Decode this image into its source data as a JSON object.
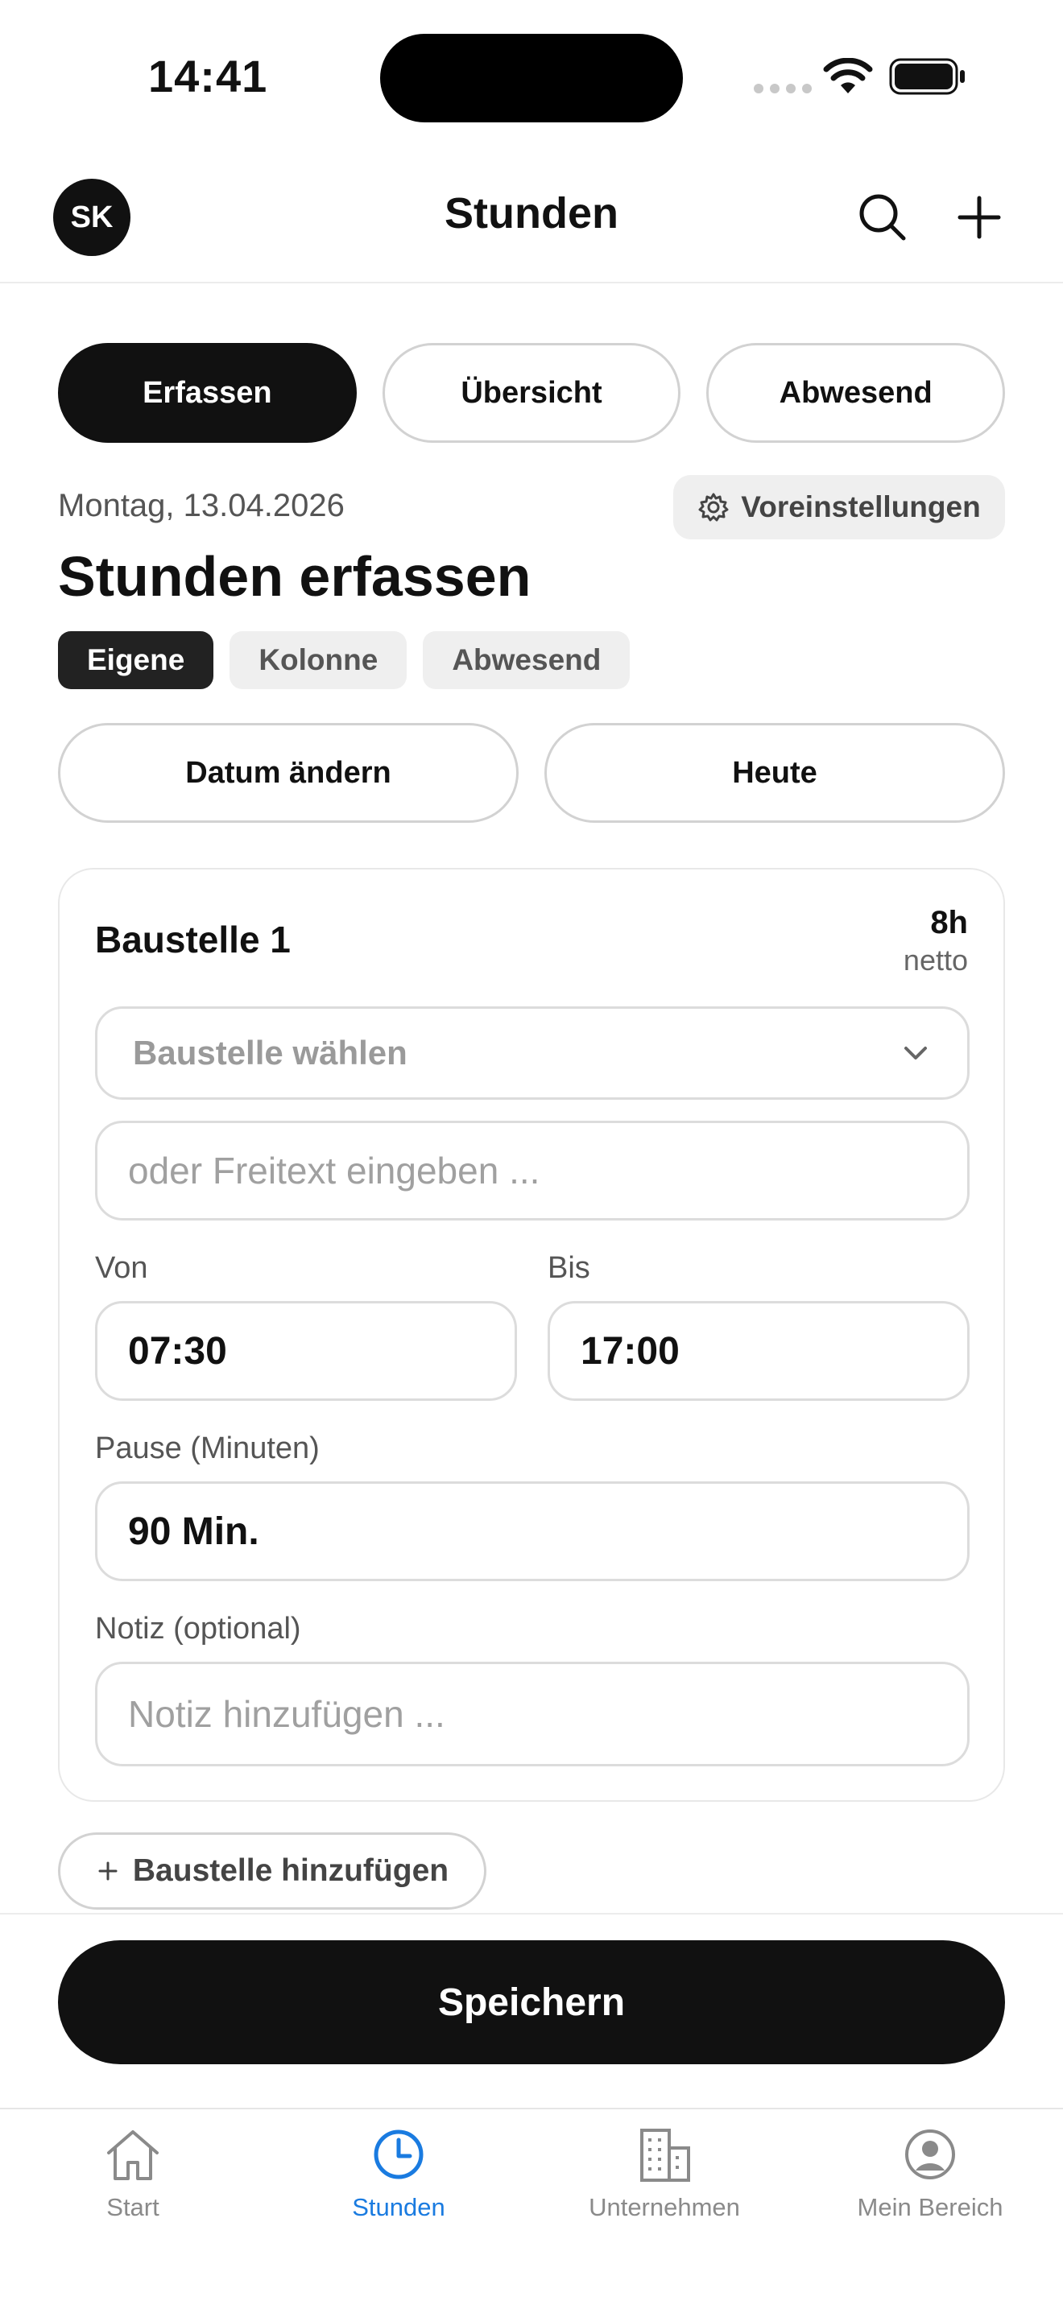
{
  "status_bar": {
    "time": "14:41"
  },
  "header": {
    "avatar_initials": "SK",
    "title": "Stunden"
  },
  "main_tabs": [
    {
      "label": "Erfassen",
      "active": true
    },
    {
      "label": "Übersicht",
      "active": false
    },
    {
      "label": "Abwesend",
      "active": false
    }
  ],
  "date_label": "Montag, 13.04.2026",
  "preset_button_label": "Voreinstellungen",
  "page_heading": "Stunden erfassen",
  "type_chips": [
    {
      "label": "Eigene",
      "active": true
    },
    {
      "label": "Kolonne",
      "active": false
    },
    {
      "label": "Abwesend",
      "active": false
    }
  ],
  "date_actions": {
    "change_label": "Datum ändern",
    "today_label": "Heute"
  },
  "entry_card": {
    "title": "Baustelle 1",
    "net_hours": "8h",
    "net_label": "netto",
    "site_select_placeholder": "Baustelle wählen",
    "freetext_placeholder": "oder Freitext eingeben ...",
    "from_label": "Von",
    "from_value": "07:30",
    "to_label": "Bis",
    "to_value": "17:00",
    "break_label": "Pause (Minuten)",
    "break_value": "90 Min.",
    "note_label": "Notiz (optional)",
    "note_placeholder": "Notiz hinzufügen ..."
  },
  "add_site_label": "Baustelle hinzufügen",
  "save_label": "Speichern",
  "tabbar": [
    {
      "label": "Start",
      "icon": "home-icon",
      "active": false
    },
    {
      "label": "Stunden",
      "icon": "clock-icon",
      "active": true
    },
    {
      "label": "Unternehmen",
      "icon": "building-icon",
      "active": false
    },
    {
      "label": "Mein Bereich",
      "icon": "profile-icon",
      "active": false
    }
  ],
  "colors": {
    "accent": "#1a7be0",
    "primary": "#111111"
  }
}
